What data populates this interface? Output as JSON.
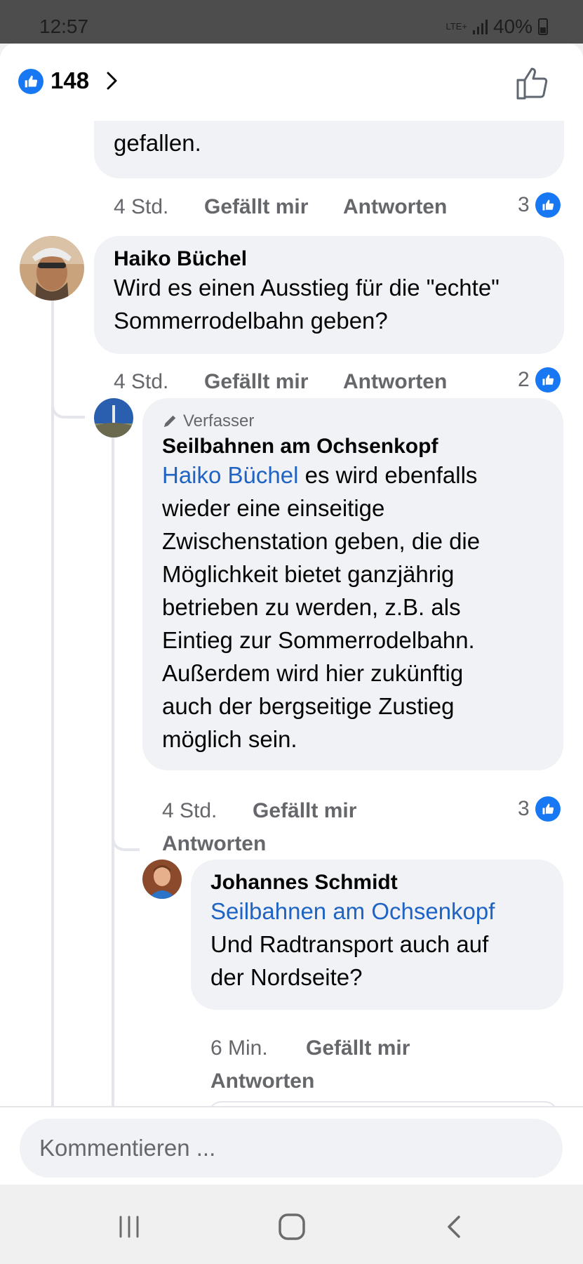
{
  "status_bar": {
    "time": "12:57",
    "network": "LTE+",
    "battery": "40%"
  },
  "header": {
    "like_count": "148"
  },
  "comments": [
    {
      "text_tail": "gefallen.",
      "time": "4 Std.",
      "like_label": "Gefällt mir",
      "reply_label": "Antworten",
      "reactions": "3"
    },
    {
      "author": "Haiko Büchel",
      "text": "Wird es einen Ausstieg für die \"echte\" Sommerrodelbahn geben?",
      "time": "4 Std.",
      "like_label": "Gefällt mir",
      "reply_label": "Antworten",
      "reactions": "2"
    },
    {
      "badge": "Verfasser",
      "author": "Seilbahnen am Ochsenkopf",
      "mention": "Haiko Büchel",
      "text_lines": [
        "es wird ebenfalls",
        "wieder eine einseitige",
        "Zwischenstation geben, die die",
        "Möglichkeit bietet ganzjährig",
        "betrieben zu werden, z.B. als",
        "Eintieg zur Sommerrodelbahn.",
        "Außerdem wird hier zukünftig",
        "auch der bergseitige Zustieg",
        "möglich sein."
      ],
      "time": "4 Std.",
      "like_label": "Gefällt mir",
      "reply_label": "Antworten",
      "reactions": "3"
    },
    {
      "author": "Johannes Schmidt",
      "mention": "Seilbahnen am Ochsenkopf",
      "text_lines": [
        "Und Radtransport auch auf",
        "der Nordseite?"
      ],
      "time": "6 Min.",
      "like_label": "Gefällt mir",
      "reply_label": "Antworten"
    }
  ],
  "composer": {
    "placeholder": "Kommentieren ..."
  },
  "colors": {
    "accent": "#1877f2",
    "mention": "#1f64c4",
    "bubble": "#f0f2f5",
    "meta": "#65676b"
  }
}
